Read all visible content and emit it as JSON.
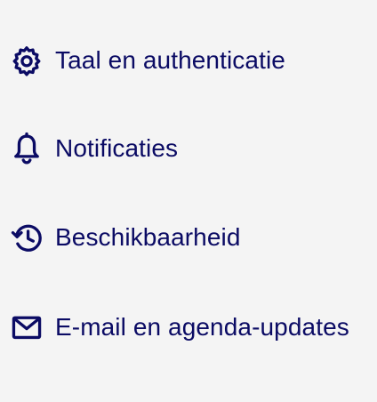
{
  "theme": {
    "background": "#f4f4f4",
    "accent": "#0b0b64"
  },
  "menu": {
    "items": [
      {
        "label": "Taal en authenticatie",
        "icon": "gear-icon"
      },
      {
        "label": "Notificaties",
        "icon": "bell-icon"
      },
      {
        "label": "Beschikbaarheid",
        "icon": "history-clock-icon"
      },
      {
        "label": "E-mail en agenda-updates",
        "icon": "envelope-icon"
      }
    ]
  }
}
